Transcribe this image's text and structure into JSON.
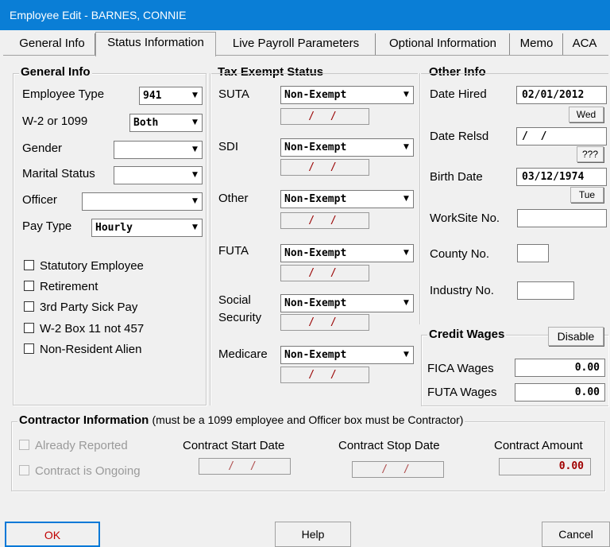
{
  "window": {
    "title": "Employee Edit - BARNES, CONNIE"
  },
  "tabs": [
    "General Info",
    "Status Information",
    "Live Payroll Parameters",
    "Optional Information",
    "Memo",
    "ACA"
  ],
  "general_info": {
    "title": "General Info",
    "employee_type": {
      "label": "Employee Type",
      "value": "941"
    },
    "w2_1099": {
      "label": "W-2 or 1099",
      "value": "Both"
    },
    "gender": {
      "label": "Gender",
      "value": ""
    },
    "marital_status": {
      "label": "Marital Status",
      "value": ""
    },
    "officer": {
      "label": "Officer",
      "value": ""
    },
    "pay_type": {
      "label": "Pay Type",
      "value": "Hourly"
    },
    "checkboxes": [
      "Statutory Employee",
      "Retirement",
      "3rd Party Sick Pay",
      "W-2 Box 11 not 457",
      "Non-Resident Alien"
    ]
  },
  "tax_exempt": {
    "title": "Tax Exempt Status",
    "rows": [
      {
        "label": "SUTA",
        "label2": "",
        "value": "Non-Exempt",
        "date": "/ /"
      },
      {
        "label": "SDI",
        "label2": "",
        "value": "Non-Exempt",
        "date": "/ /"
      },
      {
        "label": "Other",
        "label2": "",
        "value": "Non-Exempt",
        "date": "/ /"
      },
      {
        "label": "FUTA",
        "label2": "",
        "value": "Non-Exempt",
        "date": "/ /"
      },
      {
        "label": "Social",
        "label2": "Security",
        "value": "Non-Exempt",
        "date": "/ /"
      },
      {
        "label": "Medicare",
        "label2": "",
        "value": "Non-Exempt",
        "date": "/ /"
      }
    ]
  },
  "other_info": {
    "title": "Other Info",
    "date_hired": {
      "label": "Date Hired",
      "value": "02/01/2012",
      "day": "Wed"
    },
    "date_relsd": {
      "label": "Date Relsd",
      "value": "/  /",
      "day": "???"
    },
    "birth_date": {
      "label": "Birth Date",
      "value": "03/12/1974",
      "day": "Tue"
    },
    "worksite": {
      "label": "WorkSite No.",
      "value": ""
    },
    "county": {
      "label": "County No.",
      "value": ""
    },
    "industry": {
      "label": "Industry No.",
      "value": ""
    }
  },
  "credit_wages": {
    "title": "Credit Wages",
    "disable_label": "Disable",
    "fica": {
      "label": "FICA Wages",
      "value": "0.00"
    },
    "futa": {
      "label": "FUTA Wages",
      "value": "0.00"
    }
  },
  "contractor": {
    "title": "Contractor Information",
    "note": "(must be a 1099 employee and Officer box must be Contractor)",
    "already_reported": "Already Reported",
    "ongoing": "Contract is Ongoing",
    "start_label": "Contract Start Date",
    "start_value": "/ /",
    "stop_label": "Contract Stop Date",
    "stop_value": "/ /",
    "amount_label": "Contract Amount",
    "amount_value": "0.00"
  },
  "buttons": {
    "ok": "OK",
    "help": "Help",
    "cancel": "Cancel"
  }
}
